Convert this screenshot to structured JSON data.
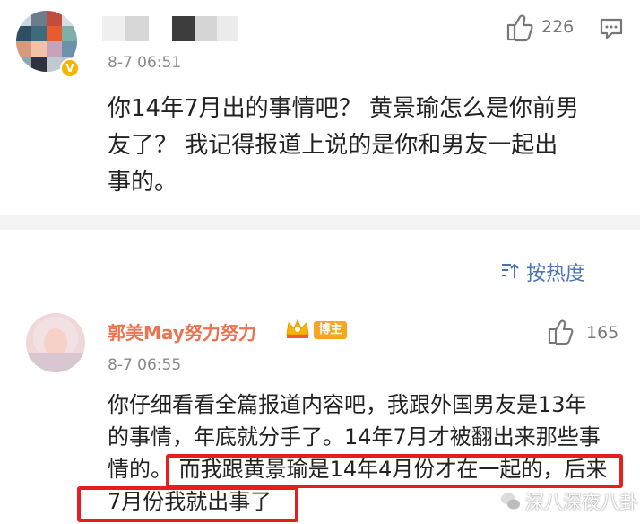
{
  "comment1": {
    "time": "8-7 06:51",
    "likes": "226",
    "body": "你14年7月出的事情吧？ 黄景瑜怎么是你前男\n友了？ 我记得报道上说的是你和男友一起出\n事的。"
  },
  "sort": {
    "label": "按热度"
  },
  "comment2": {
    "author": "郭美May努力努力",
    "badge": "博主",
    "time": "8-7 06:55",
    "likes": "165",
    "body": "你仔细看看全篇报道内容吧，我跟外国男友是13年\n的事情，年底就分手了。14年7月才被翻出来那些事\n情的。 而我跟黄景瑜是14年4月份才在一起的，后来\n7月份我就出事了"
  },
  "watermark": {
    "text": "深八深夜八卦"
  },
  "colors": {
    "author_name": "#eb7350",
    "sort_label": "#4a72b5",
    "highlight": "#e81d1d",
    "badge": "#f6a623",
    "verified": "#f6b400"
  }
}
